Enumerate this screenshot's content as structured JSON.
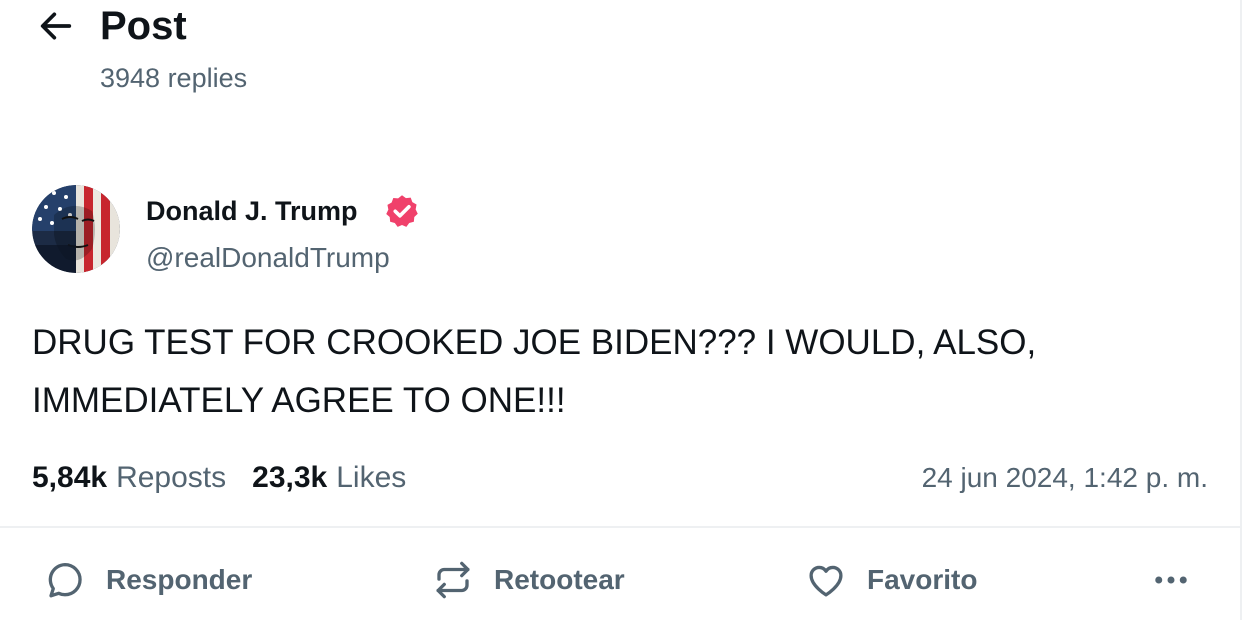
{
  "header": {
    "title": "Post",
    "replies_text": "3948 replies",
    "back_icon": "arrow-left-icon"
  },
  "author": {
    "name": "Donald J. Trump",
    "handle": "@realDonaldTrump",
    "verified": true,
    "verified_color": "#f0416b"
  },
  "post": {
    "text": "DRUG TEST FOR CROOKED JOE BIDEN??? I WOULD, ALSO, IMMEDIATELY AGREE TO ONE!!!",
    "timestamp": "24 jun 2024, 1:42 p. m."
  },
  "stats": {
    "reposts_count": "5,84k",
    "reposts_label": "Reposts",
    "likes_count": "23,3k",
    "likes_label": "Likes"
  },
  "actions": {
    "reply_label": "Responder",
    "repost_label": "Retootear",
    "favorite_label": "Favorito",
    "more_icon": "ellipsis-icon"
  },
  "colors": {
    "text": "#0f1419",
    "muted": "#536471",
    "divider": "#eef0f2"
  }
}
